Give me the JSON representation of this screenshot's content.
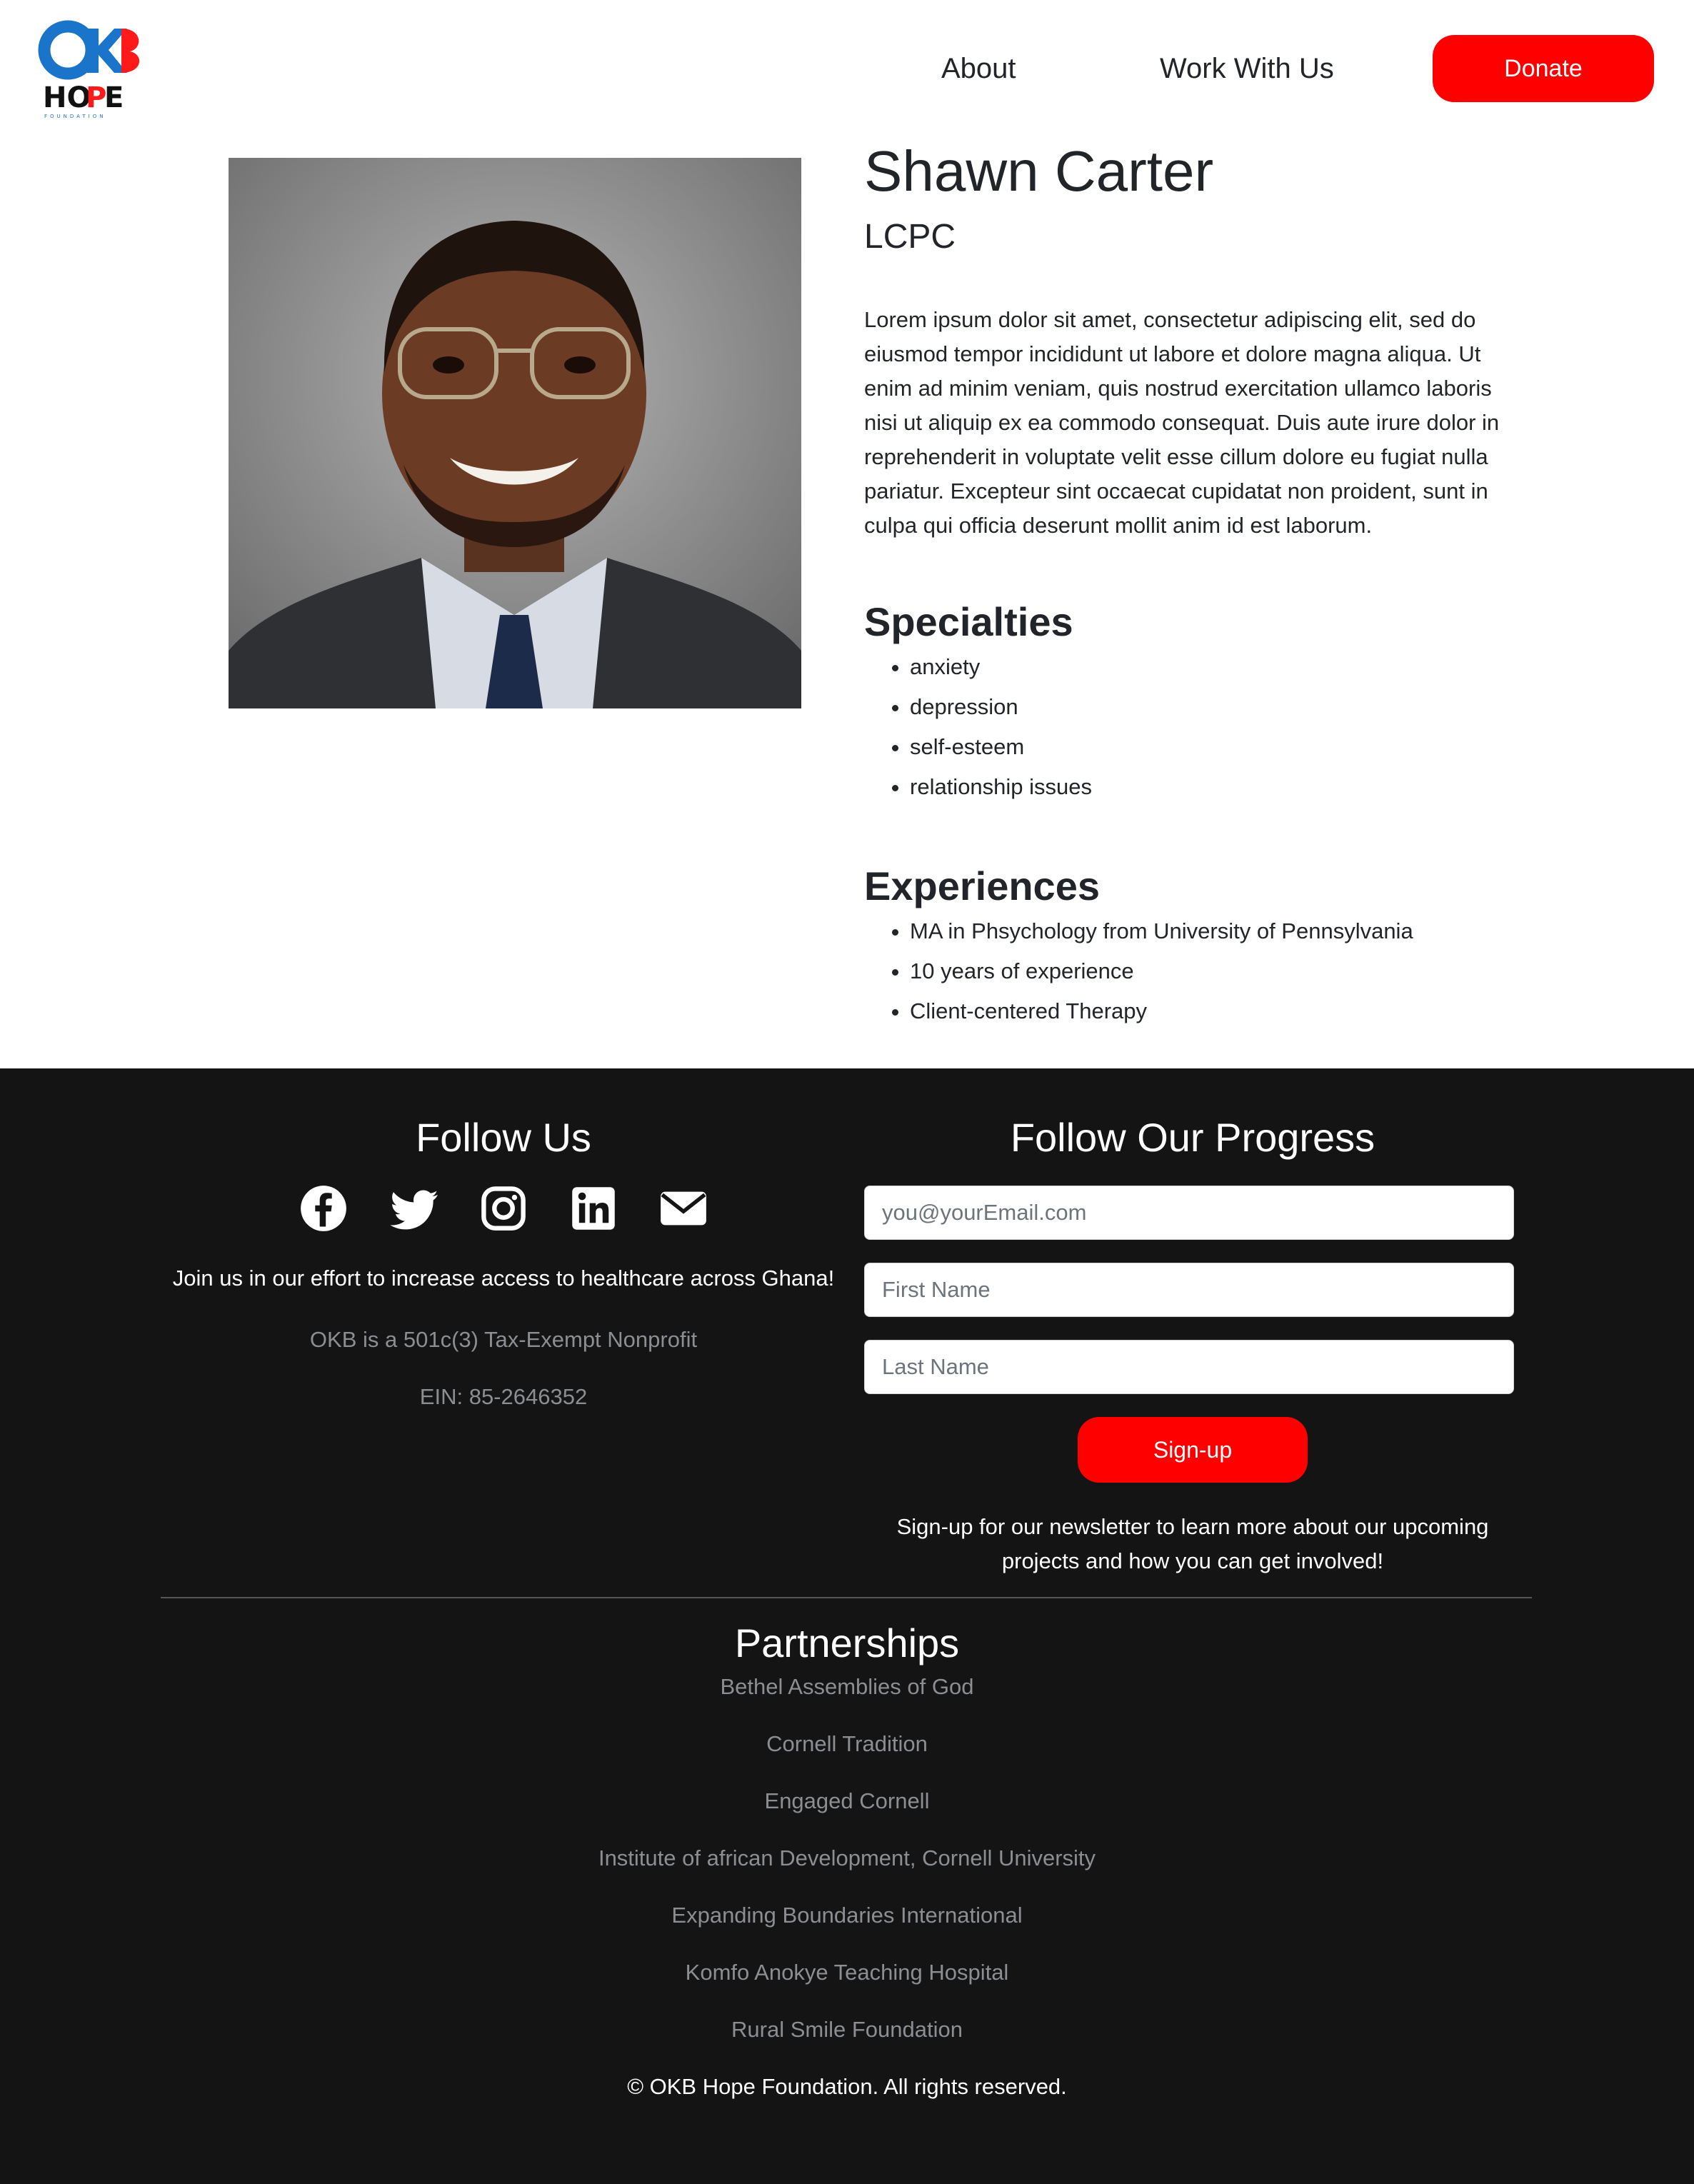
{
  "header": {
    "logo_alt": "OKB Hope Foundation",
    "nav": [
      {
        "label": "About"
      },
      {
        "label": "Work With Us"
      }
    ],
    "donate_label": "Donate",
    "colors": {
      "accent": "#ff0000",
      "logo_blue": "#1a74c9"
    }
  },
  "profile": {
    "name": "Shawn Carter",
    "credentials": "LCPC",
    "bio": "Lorem ipsum dolor sit amet, consectetur adipiscing elit, sed do eiusmod tempor incididunt ut labore et dolore magna aliqua. Ut enim ad minim veniam, quis nostrud exercitation ullamco laboris nisi ut aliquip ex ea commodo consequat. Duis aute irure dolor in reprehenderit in voluptate velit esse cillum dolore eu fugiat nulla pariatur. Excepteur sint occaecat cupidatat non proident, sunt in culpa qui officia deserunt mollit anim id est laborum.",
    "specialties_heading": "Specialties",
    "specialties": [
      "anxiety",
      "depression",
      "self-esteem",
      "relationship issues"
    ],
    "experiences_heading": "Experiences",
    "experiences": [
      "MA in Phsychology from University of Pennsylvania",
      "10 years of experience",
      "Client-centered Therapy"
    ]
  },
  "footer": {
    "follow_heading": "Follow Us",
    "social_icons": [
      "facebook-icon",
      "twitter-icon",
      "instagram-icon",
      "linkedin-icon",
      "envelope-icon"
    ],
    "join_text": "Join us in our effort to increase access to healthcare across Ghana!",
    "tax_text": "OKB is a 501c(3) Tax-Exempt Nonprofit",
    "ein_text": "EIN: 85-2646352",
    "progress_heading": "Follow Our Progress",
    "email_placeholder": "you@yourEmail.com",
    "first_name_placeholder": "First Name",
    "last_name_placeholder": "Last Name",
    "signup_label": "Sign-up",
    "newsletter_text": "Sign-up for our newsletter to learn more about our upcoming projects and how you can get involved!",
    "partnerships_heading": "Partnerships",
    "partners": [
      "Bethel Assemblies of God",
      "Cornell Tradition",
      "Engaged Cornell",
      "Institute of african Development, Cornell University",
      "Expanding Boundaries International",
      "Komfo Anokye Teaching Hospital",
      "Rural Smile Foundation"
    ],
    "copyright": "© OKB Hope Foundation. All rights reserved.",
    "colors": {
      "background": "#141414",
      "muted_text": "#8b8e92"
    }
  }
}
